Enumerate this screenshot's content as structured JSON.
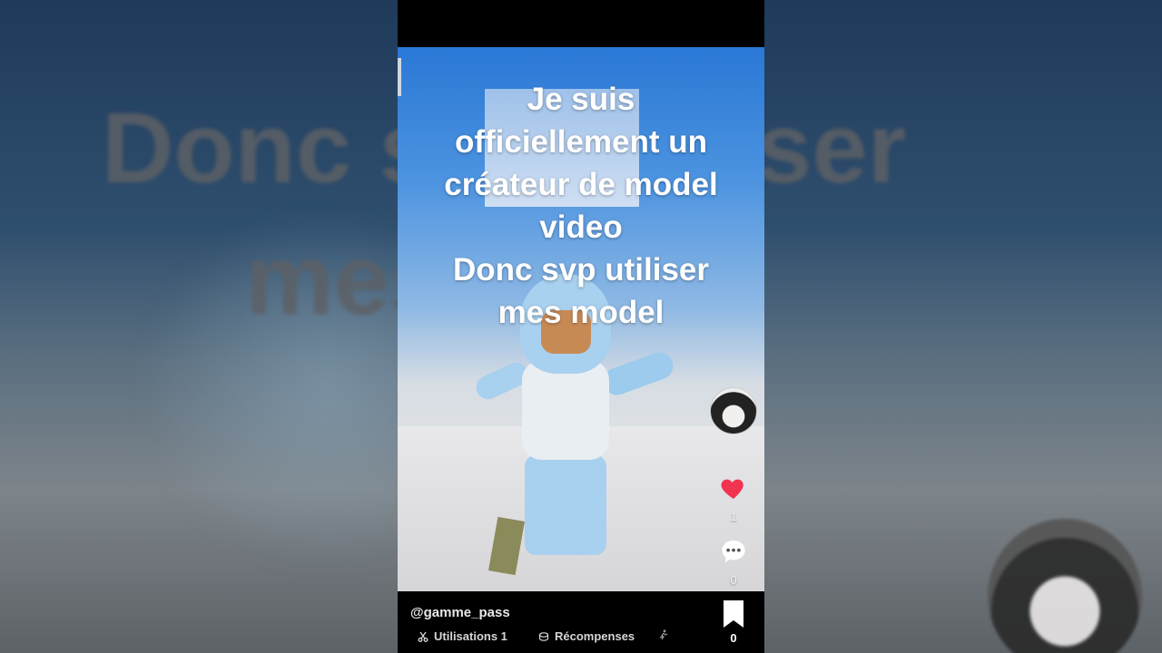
{
  "background": {
    "blurred_lines": [
      "Donc svp utiliser",
      "mes model"
    ]
  },
  "video": {
    "caption_lines": [
      "Je suis",
      "officiellement un",
      "créateur de model",
      "video",
      "Donc svp utiliser",
      "mes model"
    ]
  },
  "rail": {
    "like_count": "1",
    "comment_count": "0",
    "like_color": "#f0344f"
  },
  "footer": {
    "username": "@gamme_pass",
    "uses_label": "Utilisations 1",
    "rewards_label": "Récompenses",
    "bookmark_count": "0"
  }
}
